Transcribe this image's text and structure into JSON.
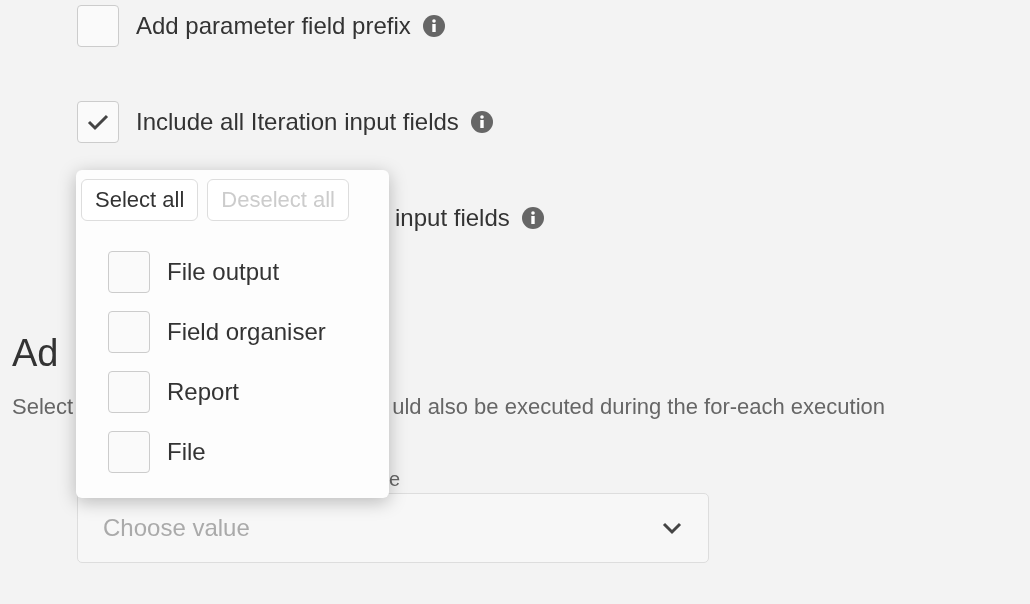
{
  "options": [
    {
      "label": "Add parameter field prefix",
      "checked": false
    },
    {
      "label": "Include all Iteration input fields",
      "checked": true
    }
  ],
  "partial_option": {
    "label": "input fields"
  },
  "section": {
    "heading": "Ad",
    "description_start": "Select",
    "description_end": "uld also be executed during the for-each execution",
    "field_label": "e",
    "select": {
      "placeholder": "Choose value"
    }
  },
  "popup": {
    "buttons": [
      {
        "label": "Select all",
        "disabled": false
      },
      {
        "label": "Deselect all",
        "disabled": true
      }
    ],
    "items": [
      {
        "label": "File output",
        "checked": false
      },
      {
        "label": "Field organiser",
        "checked": false
      },
      {
        "label": "Report",
        "checked": false
      },
      {
        "label": "File",
        "checked": false
      }
    ]
  }
}
